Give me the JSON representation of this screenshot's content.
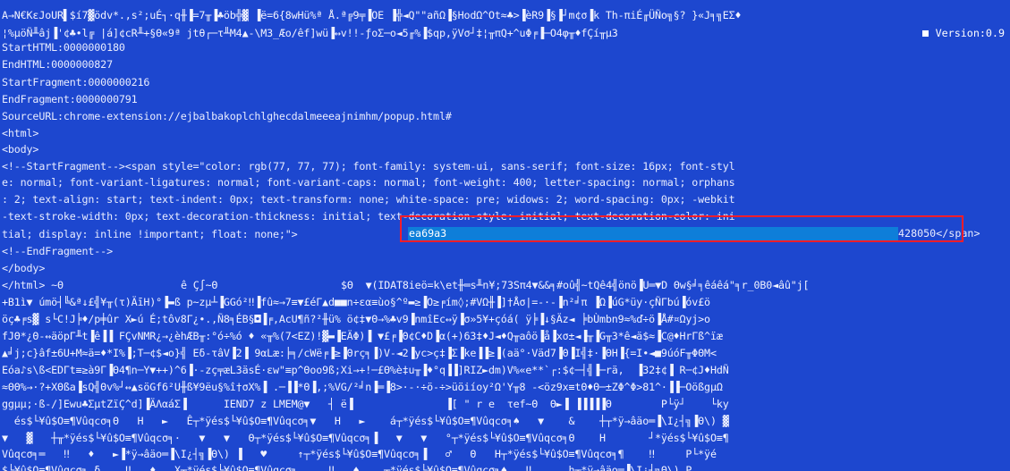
{
  "header": {
    "garbage1": "A→N€KεJoUR▌$í7▓ödv*.,s²;uÉ┐·q╫▐=7╥▐♣öb╬▓ ▐ë=6{8wHü%ª Å.ª╔9╤▐OE ▐╬◄Q\"\"añΩ▐§HodΩ^Ot≈♣>▐èR9▐§▐┘m¢σ▐k Th-πiÉ╓ÜÑo╗§? }«J╕╗EΣ♦",
    "garbage2": "¦%µöÑ╨âj▐'¢♣•l╔ |á]¢cR╨+§Θ«9ª jtθ┌─τ╨M4▲-\\M3_Æo/êf]wü▐↔v!!-ƒoΣ─o◄5╓%▐$qp,ÿVσ┘‡¦╥πQ+^uΦ╒▐─O4φ╥♦fÇí╥µ3",
    "version": "Version:0.9"
  },
  "lines": {
    "start_html": "StartHTML:0000000180",
    "end_html": "EndHTML:0000000827",
    "start_fragment": "StartFragment:0000000216",
    "end_fragment": "EndFragment:0000000791",
    "source_url": "SourceURL:chrome-extension://ejbalbakoplchlghecdalmeeeajnimhm/popup.html#",
    "html_open": "<html>",
    "body_open": "<body>",
    "frag_line1": "<!--StartFragment--><span style=\"color: rgb(77, 77, 77); font-family: system-ui, sans-serif; font-size: 16px; font-styl",
    "frag_line2": "e: normal; font-variant-ligatures: normal; font-variant-caps: normal; font-weight: 400; letter-spacing: normal; orphans",
    "frag_line3": ": 2; text-align: start; text-indent: 0px; text-transform: none; white-space: pre; widows: 2; word-spacing: 0px; -webkit",
    "frag_line4": "-text-stroke-width: 0px; text-decoration-thickness: initial; text-decoration-style: initial; text-decoration-color: ini",
    "frag_line5_prefix": "tial; display: inline !important; float: none;\">",
    "hex_value_start": "ea69a3",
    "hex_value_end": "428050",
    "span_close": "</span>",
    "end_fragment_comment": "<!--EndFragment-->",
    "body_close": "</body>",
    "html_close": "</html> ~Θ",
    "html_close_tail": "ê Ç∫~Θ                    $Θ  ▼(IDAT8ieö=k\\et╫═s╨n¥;73Sπ4▼&&╕#oû╣~tQê4╣önö▐U═▼D Θw§╛╕êáêá\"╕r_0B0◄âû\"j["
  },
  "binary_lines": [
    "+B1ì▼ úmö┤╚&ª↓£╣¥╥(τ)ÄīH)°▐▬ß p~zµ┴▐GGó²‼▐fû≈→7≡▼£éΓ▲d■■n÷εα≡ùo§^º▬≥▐O≥╒ím◊;#VΩ╫▐]†Åσ|=-·-▐n²╛π ▐Ω▐úG*üy·çÑΓbú▐óv£ö",
    "öç♣╒s▓ s└C!J╞♦/p╪ûr X►ú É;tôv8Γ¿•.,Ñ8╕ÉB§◘▐╒,AcU¶ñ?²╫ü% ö¢‡▼Θ→%♣v9▐nmîEc↔ÿ▐σ»5¥+çóá( ÿ╞▐↓§Äz◄ ╞bÙmbn9≈%ď÷ö▐Å#¤Ωyj>o",
    "fJΘ*¿Θ-↔äöpΓ╨t▐ê▐▐ FÇvNMR¿→¿èhÆB╥:°ó÷%ó ♦ «╥%(7<EZ)!▓▬▐EÄΦ)▐ ▼£╒▐Θ¢C♦D▐α(+)63‡♦J◄♦Q╥aôö▐å▐xσ±◄▐╥▐G╥3*ê◄ä$≈▐C@♦HrΓß^ïæ",
    "▲╛j;c}âf±6U+M≈ä=♦*I%▐;T─¢$◄o}╣ Eδ-τâV▐2▐ 9αLæ:╞╕/cWë╒▐≥▐Θrç╕▐)V-◄2▐yc>ç‡▐Σ▐ke▐▐≥▐(aä°·Väd7▐Θ▐I╣‡·▐ΘH▐{=I•◄■9úóF╥ΦΘM<",
    "Eóa♪s\\ß<EDΓt≡≥à9Γ▐Θ4¶n─Y▼++)^6▐·-zç╤æL3äsÉ·εw\"≡p^Θoo9ß;Xi→+!─£Θ%è‡u╥▐♦°q▐▐]RIZ►dm)V%«e**`┌:$¢─┤╣▐─rä,  ▐32‡¢▐ R─¢J♦HdÑ",
    "≈ΘΘ%→·?+XΘßa▐sQ╣Θv%┘↔▲söGf6²U╫ß¥9ëu§%î†σX%▐ .─▐▐*Θ▐,;%VG/²╛n▐═▐8>·-·÷ö-÷>üöiíoy²Ω'Y╥8 -<öz9x≡tΘ♦Θ─±ZΦ^Φ>81^·▐▐─OößgµΩ",
    "ggµµ;·ß-/]Ewu♣ΣµtZïÇ^d]▐ÄΛαáΣ▐      IEND7 z LMEM@▼   ┤ ë▐               ▐[ \" r e  τef~Θ  Θ►▐ ▐▐▐▐▐Θ        P└ÿ┘    └ky",
    "  és$└¥û$O≡¶Vûqcσ╕Θ   H   ►   Ê┬*ÿés$└¥û$O≡¶Vûqcσ╕▼   H   ►    á┬*ÿés$└¥û$O≡¶Vûqcσ╕♠   ▼    &    ┼┬*ÿ→âäo═▐\\I¿┤╗▐Θ\\) ▓",
    "▼   ▓   ┼╥*ÿés$└¥û$O≡¶Vûqcσ╕·   ▼   ▼   Θ┬*ÿés$└¥û$O≡¶Vûqcσ╕▐   ▼   ▼   °┬*ÿés$└¥û$O≡¶Vûqcσ╕Θ    H       ┘*ÿés$└¥û$O≡¶",
    "Vûqcσ╕═   ‼   ♦   ►▐*ÿ→âäo═▐\\I¿┤╗▐Θ\\) ▐   ♥     ↑┬*ÿés$└¥û$O≡¶Vûqcσ╕▐   ♂   Θ   H┬*ÿés$└¥û$O≡¶Vûqcσ╕¶    ‼     P└*ÿé",
    "$└¥û$O≡¶Vûqcσ╕ δ    ‼   ♦   X┬*ÿés$└¥û$O≡¶Vûqcσ╕     ‼   ♠    ┬*ÿés$└¥û$O≡¶Vûqcσ╕♠   ‼      h┬*ÿ→âäo═▐\\I¿┤╗Θ\\) P"
  ]
}
